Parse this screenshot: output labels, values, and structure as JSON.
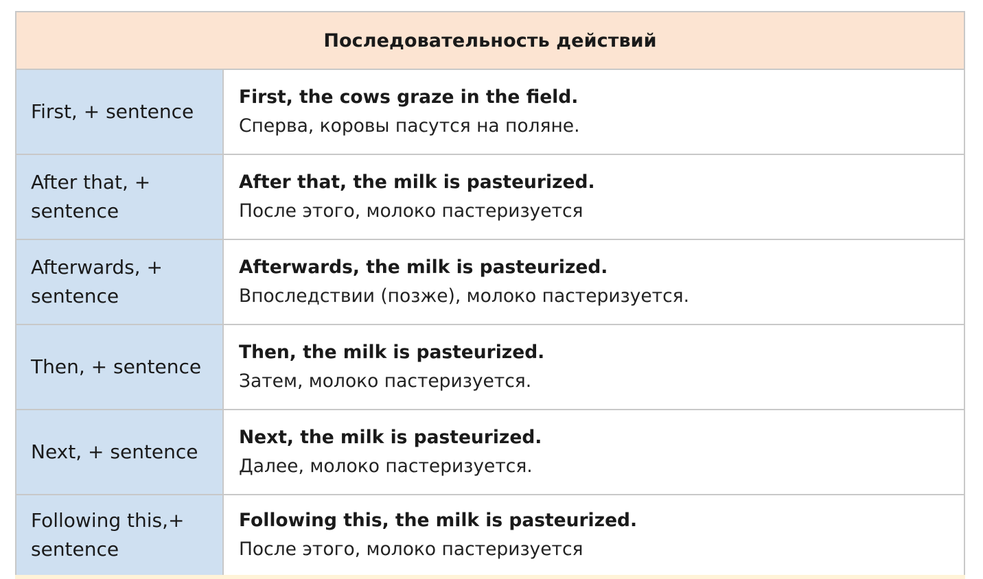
{
  "table": {
    "header": "Последовательность действий",
    "rows": [
      {
        "phrase": "First, + sentence",
        "example_en": "First, the cows graze in the field.",
        "example_ru": "Сперва, коровы пасутся на поляне."
      },
      {
        "phrase": "After that, + sentence",
        "example_en": "After that, the milk is pasteurized.",
        "example_ru": "После этого, молоко пастеризуется"
      },
      {
        "phrase": "Afterwards, + sentence",
        "example_en": "Afterwards, the milk is pasteurized.",
        "example_ru": "Впоследствии (позже), молоко пастеризуется."
      },
      {
        "phrase": "Then, + sentence",
        "example_en": "Then, the milk is pasteurized.",
        "example_ru": "Затем, молоко пастеризуется."
      },
      {
        "phrase": "Next, + sentence",
        "example_en": "Next, the milk is pasteurized.",
        "example_ru": "Далее, молоко пастеризуется."
      },
      {
        "phrase": "Following this,+ sentence",
        "example_en": "Following this, the milk is pasteurized.",
        "example_ru": "После этого, молоко пастеризуется"
      }
    ]
  },
  "colors": {
    "header_bg": "#fce4d2",
    "phrase_bg": "#cfe0f1",
    "border": "#c8c8c8"
  }
}
